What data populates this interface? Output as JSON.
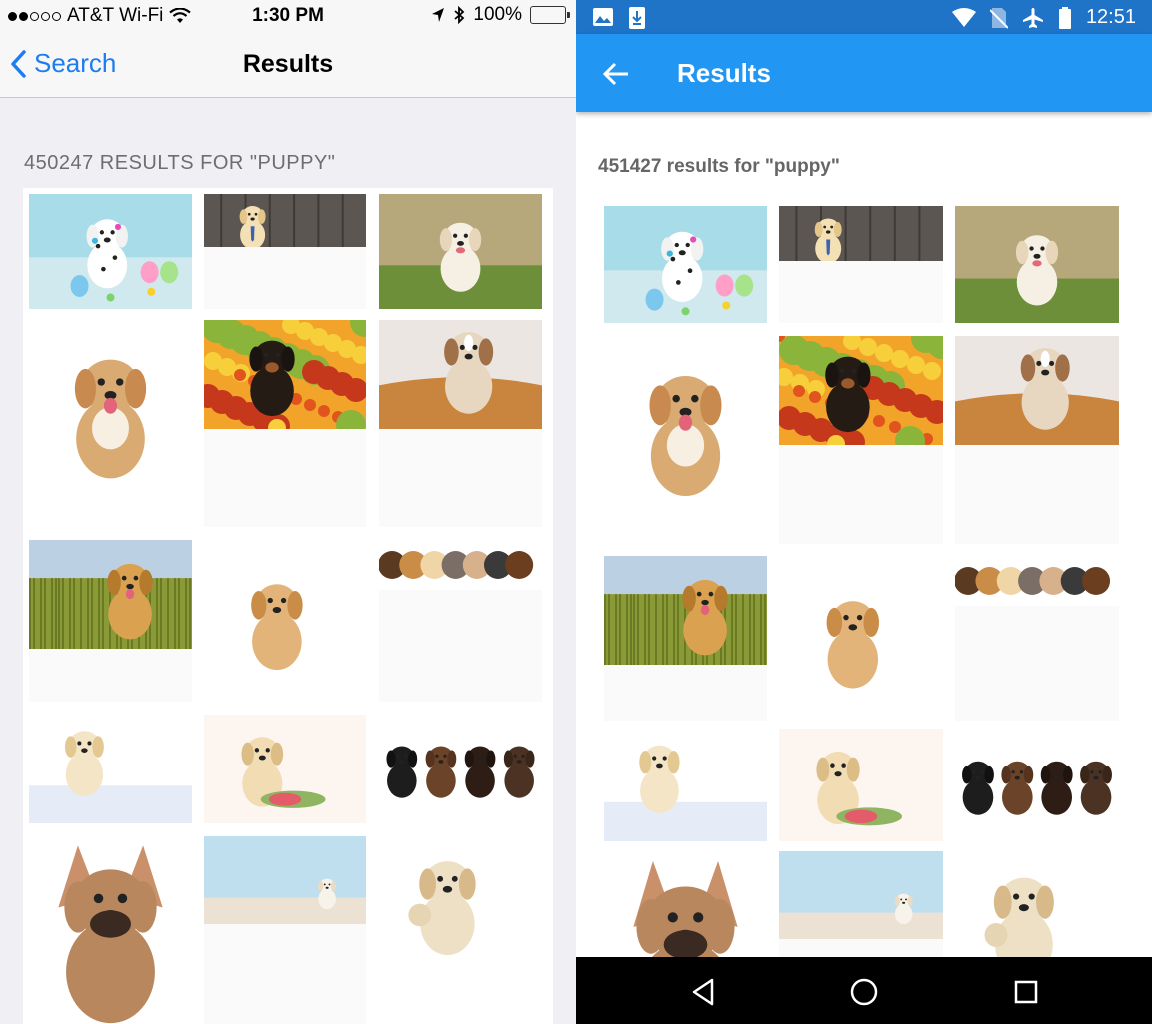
{
  "ios": {
    "status": {
      "carrier": "AT&T Wi-Fi",
      "time": "1:30 PM",
      "battery": "100%"
    },
    "nav": {
      "back_label": "Search",
      "title": "Results"
    },
    "results_count": "450247 RESULTS FOR \"PUPPY\"",
    "images": [
      "dalmatian-puppy-with-paint-and-easter-eggs",
      "labrador-puppy-with-tie",
      "white-puppy-running-on-grass",
      "fluffy-puppy-sitting",
      "rottweiler-puppy-in-autumn-leaves",
      "chihuahua-puppy-in-basket",
      "golden-retriever-puppy-in-meadow",
      "golden-retriever-puppy-walking",
      "row-of-puppies-and-kittens",
      "labrador-puppy-peeking-over-board",
      "labrador-puppy-with-rope-toy",
      "row-of-four-labrador-puppies",
      "french-bulldog-puppy",
      "white-puppy-in-studio",
      "labrador-puppy-waving-paw"
    ]
  },
  "android": {
    "status": {
      "time": "12:51"
    },
    "toolbar": {
      "title": "Results"
    },
    "results_count": "451427 results for \"puppy\"",
    "nav": {
      "back": "back-triangle-icon",
      "home": "home-circle-icon",
      "recents": "recents-square-icon"
    }
  },
  "colors": {
    "ios_blue": "#1d7df0",
    "android_primary": "#2196f3",
    "android_status": "#1f74c7",
    "battery_green": "#4cd964"
  }
}
